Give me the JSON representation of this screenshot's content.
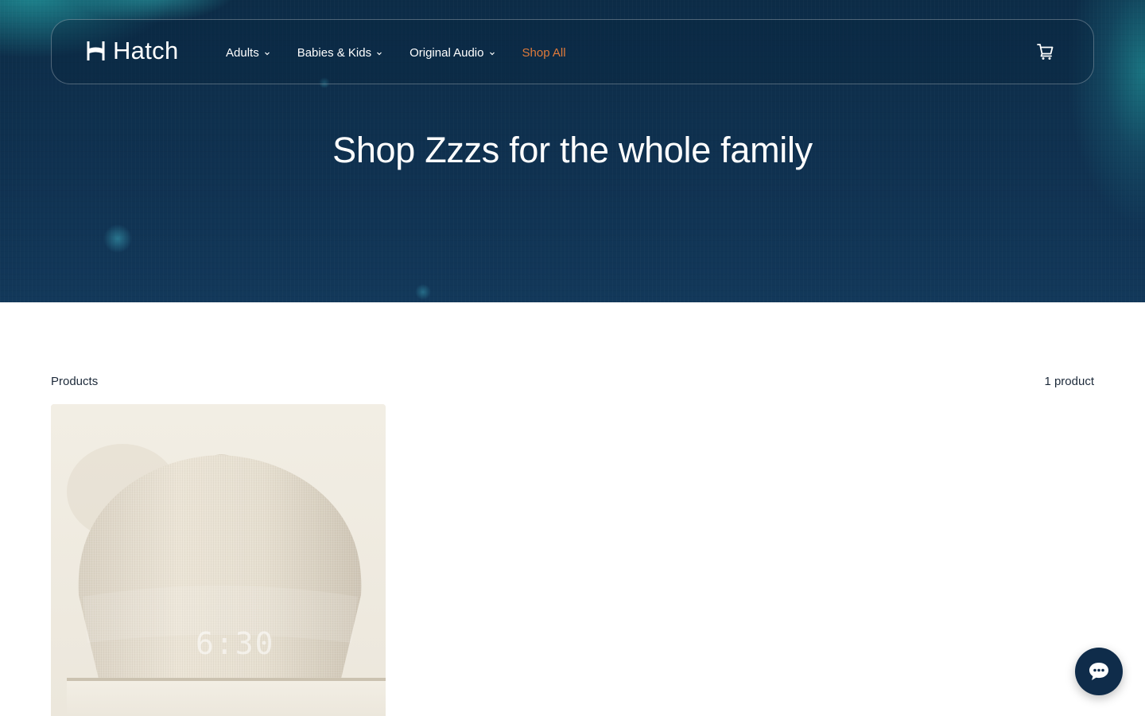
{
  "brand": {
    "name": "Hatch"
  },
  "nav": {
    "items": [
      {
        "label": "Adults",
        "has_dropdown": true
      },
      {
        "label": "Babies & Kids",
        "has_dropdown": true
      },
      {
        "label": "Original Audio",
        "has_dropdown": true
      },
      {
        "label": "Shop All",
        "has_dropdown": false,
        "active": true
      }
    ],
    "cart_icon": "shopping-cart-icon"
  },
  "hero": {
    "title": "Shop Zzzs for the whole family"
  },
  "products": {
    "label": "Products",
    "count_text": "1 product",
    "items": [
      {
        "image_icon": "sunrise-alarm-clock-product-image",
        "clock_display": "6:30"
      }
    ]
  },
  "chat": {
    "icon": "chat-bubble-icon"
  },
  "colors": {
    "hero_background": "#0f3150",
    "accent_active_nav": "#e07a3a",
    "chat_button": "#0f2c4a",
    "product_background": "#f1ede3"
  }
}
